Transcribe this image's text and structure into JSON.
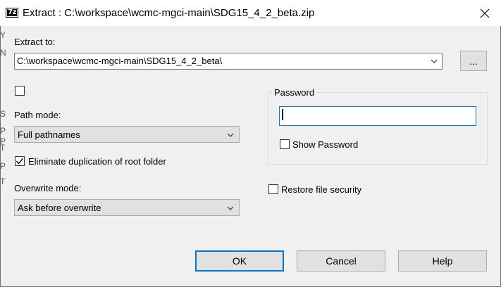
{
  "window": {
    "title": "Extract : C:\\workspace\\wcmc-mgci-main\\SDG15_4_2_beta.zip",
    "app_icon": "7z",
    "close_icon": "close-icon"
  },
  "extract_to": {
    "label": "Extract to:",
    "value": "C:\\workspace\\wcmc-mgci-main\\SDG15_4_2_beta\\",
    "browse_label": "..."
  },
  "options": {
    "first_checkbox_checked": false,
    "path_mode_label": "Path mode:",
    "path_mode_value": "Full pathnames",
    "eliminate_dup_label": "Eliminate duplication of root folder",
    "eliminate_dup_checked": true,
    "overwrite_mode_label": "Overwrite mode:",
    "overwrite_mode_value": "Ask before overwrite"
  },
  "password": {
    "group_label": "Password",
    "value": "",
    "show_password_label": "Show Password",
    "show_password_checked": false
  },
  "restore_security": {
    "label": "Restore file security",
    "checked": false
  },
  "buttons": {
    "ok": "OK",
    "cancel": "Cancel",
    "help": "Help"
  },
  "background_window_chars": [
    "Y",
    "N",
    "S",
    "P",
    "P",
    "T",
    "P",
    "T"
  ],
  "colors": {
    "focus": "#0078d7",
    "button_bg": "#e1e1e1",
    "dialog_bg": "#f0f0f0"
  }
}
